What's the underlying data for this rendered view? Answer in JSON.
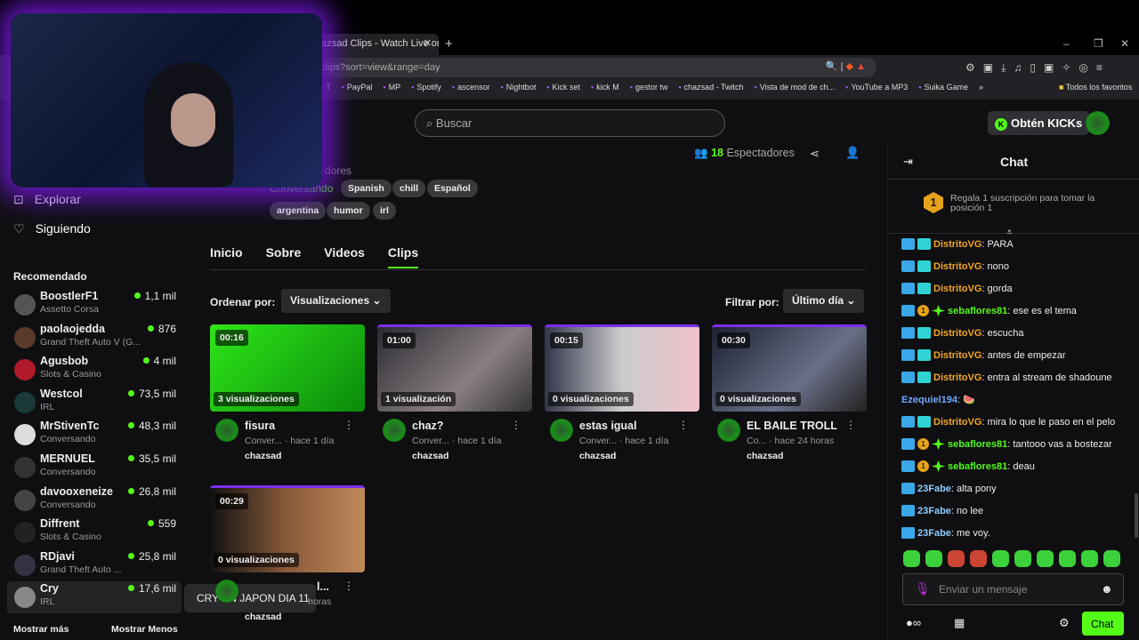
{
  "browser": {
    "tab_title": "hazsad Clips - Watch Live on Ki",
    "tab_close": "✕",
    "new_tab": "+",
    "url": "/clips?sort=view&range=day",
    "win": [
      "–",
      "❐",
      "✕"
    ],
    "bookmarks": [
      "T",
      "PayPal",
      "MP",
      "Spotify",
      "ascensor",
      "Nightbot",
      "Kick set",
      "kick M",
      "gestor tw",
      "chazsad - Twitch",
      "Vista de mod de ch...",
      "YouTube a MP3",
      "Suika Game"
    ],
    "more": "»",
    "favorites": "Todos los favoritos"
  },
  "header": {
    "search_placeholder": "Buscar",
    "kicks_label": "Obtén KICKs"
  },
  "sidebar": {
    "nav": [
      {
        "label": "Explorar",
        "icon": "compass-icon"
      },
      {
        "label": "Siguiendo",
        "icon": "heart-icon"
      }
    ],
    "rec_title": "Recomendado",
    "channels": [
      {
        "name": "BoostlerF1",
        "cat": "Assetto Corsa",
        "viewers": "1,1 mil"
      },
      {
        "name": "paolaojedda",
        "cat": "Grand Theft Auto V (G...",
        "viewers": "876"
      },
      {
        "name": "Agusbob",
        "cat": "Slots & Casino",
        "viewers": "4 mil"
      },
      {
        "name": "Westcol",
        "cat": "IRL",
        "viewers": "73,5 mil"
      },
      {
        "name": "MrStivenTc",
        "cat": "Conversando",
        "viewers": "48,3 mil"
      },
      {
        "name": "MERNUEL",
        "cat": "Conversando",
        "viewers": "35,5 mil"
      },
      {
        "name": "davooxeneize",
        "cat": "Conversando",
        "viewers": "26,8 mil"
      },
      {
        "name": "Diffrent",
        "cat": "Slots & Casino",
        "viewers": "559"
      },
      {
        "name": "RDjavi",
        "cat": "Grand Theft Auto ...",
        "viewers": "25,8 mil"
      },
      {
        "name": "Cry",
        "cat": "IRL",
        "viewers": "17,6 mil"
      }
    ],
    "show_more": "Mostrar más",
    "show_less": "Mostrar Menos",
    "tooltip": "CRY EN JAPON DIA 11"
  },
  "channel": {
    "viewers_count": "18",
    "viewers_label": "Espectadores",
    "partial_label": "dores",
    "category": "Conversando",
    "tags": [
      "Spanish",
      "chill",
      "Español",
      "argentina",
      "humor",
      "irl"
    ]
  },
  "tabs": [
    "Inicio",
    "Sobre",
    "Videos",
    "Clips"
  ],
  "active_tab": "Clips",
  "sort": {
    "label": "Ordenar por:",
    "value": "Visualizaciones"
  },
  "filter": {
    "label": "Filtrar por:",
    "value": "Último día"
  },
  "clips": [
    {
      "dur": "00:16",
      "views": "3 visualizaciones",
      "title": "fisura",
      "cat": "Conver...",
      "time": "· hace 1 día",
      "user": "chazsad"
    },
    {
      "dur": "01:00",
      "views": "1 visualización",
      "title": "chaz?",
      "cat": "Conver...",
      "time": "· hace 1 día",
      "user": "chazsad"
    },
    {
      "dur": "00:15",
      "views": "0 visualizaciones",
      "title": "estas igual",
      "cat": "Conver...",
      "time": "· hace 1 día",
      "user": "chazsad"
    },
    {
      "dur": "00:30",
      "views": "0 visualizaciones",
      "title": "EL BAILE TROLL",
      "cat": "Co...",
      "time": "· hace 24 horas",
      "user": "chazsad"
    },
    {
      "dur": "00:29",
      "views": "0 visualizaciones",
      "title": "l...",
      "cat": "",
      "time": "horas",
      "user": "chazsad"
    }
  ],
  "chat": {
    "title": "Chat",
    "pinned": "Regala 1 suscripción para tomar la posición 1",
    "pin_rank": "1",
    "messages": [
      {
        "badges": [
          "mod",
          "og"
        ],
        "user": "DistritoVG",
        "color": "#f5a623",
        "text": ": PARA"
      },
      {
        "badges": [
          "mod",
          "og"
        ],
        "user": "DistritoVG",
        "color": "#f5a623",
        "text": ": nono"
      },
      {
        "badges": [
          "mod",
          "og"
        ],
        "user": "DistritoVG",
        "color": "#f5a623",
        "text": ": gorda"
      },
      {
        "badges": [
          "mod",
          "sub",
          "gift"
        ],
        "user": "sebaflores81",
        "color": "#53fc18",
        "text": ": ese es el tema"
      },
      {
        "badges": [
          "mod",
          "og"
        ],
        "user": "DistritoVG",
        "color": "#f5a623",
        "text": ": escucha"
      },
      {
        "badges": [
          "mod",
          "og"
        ],
        "user": "DistritoVG",
        "color": "#f5a623",
        "text": ": antes de empezar"
      },
      {
        "badges": [
          "mod",
          "og"
        ],
        "user": "DistritoVG",
        "color": "#f5a623",
        "text": ": entra al stream de shadoune"
      },
      {
        "badges": [],
        "user": "Ezequiel194",
        "color": "#6ea8ff",
        "text": ": 🍉"
      },
      {
        "badges": [
          "mod",
          "og"
        ],
        "user": "DistritoVG",
        "color": "#f5a623",
        "text": ": mira lo que le paso en el pelo"
      },
      {
        "badges": [
          "mod",
          "sub",
          "gift"
        ],
        "user": "sebaflores81",
        "color": "#53fc18",
        "text": ": tantooo vas a bostezar"
      },
      {
        "badges": [
          "mod",
          "sub",
          "gift"
        ],
        "user": "sebaflores81",
        "color": "#53fc18",
        "text": ": deau"
      },
      {
        "badges": [
          "mod"
        ],
        "user": "23Fabe",
        "color": "#8ecbff",
        "text": ": alta pony"
      },
      {
        "badges": [
          "mod"
        ],
        "user": "23Fabe",
        "color": "#8ecbff",
        "text": ": no lee"
      },
      {
        "badges": [
          "mod"
        ],
        "user": "23Fabe",
        "color": "#8ecbff",
        "text": ": me voy."
      }
    ],
    "input_placeholder": "Enviar un mensaje",
    "send_label": "Chat"
  },
  "colors": {
    "accent": "#53fc18",
    "bg": "#0f0f11"
  }
}
